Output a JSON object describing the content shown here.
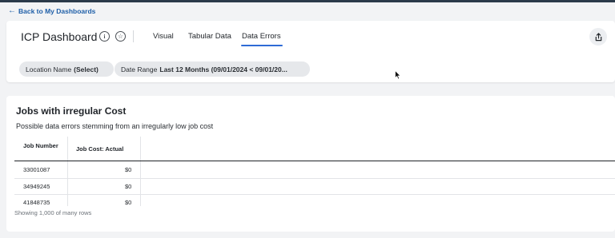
{
  "nav": {
    "back_label": "Back to My Dashboards"
  },
  "header": {
    "title": "ICP Dashboard",
    "tabs": [
      {
        "label": "Visual",
        "active": false
      },
      {
        "label": "Tabular Data",
        "active": false
      },
      {
        "label": "Data Errors",
        "active": true
      }
    ]
  },
  "filters": [
    {
      "name": "Location Name",
      "value": "(Select)"
    },
    {
      "name": "Date Range",
      "value": "Last 12 Months (09/01/2024 < 09/01/20..."
    }
  ],
  "section": {
    "title": "Jobs with irregular Cost",
    "subtitle": "Possible data errors stemming from an irregularly low job cost",
    "columns": [
      "Job Number",
      "Job Cost: Actual"
    ],
    "rows": [
      [
        "33001087",
        "$0"
      ],
      [
        "34949245",
        "$0"
      ],
      [
        "41848735",
        "$0"
      ]
    ],
    "footer": "Showing 1,000 of many rows"
  },
  "icons": {
    "back": "arrow-left-icon",
    "info": "info-icon",
    "favorite": "star-icon",
    "share": "share-icon",
    "cursor": "mouse-pointer-icon"
  },
  "colors": {
    "accent": "#2e6bd6",
    "link": "#1f5fa8"
  }
}
